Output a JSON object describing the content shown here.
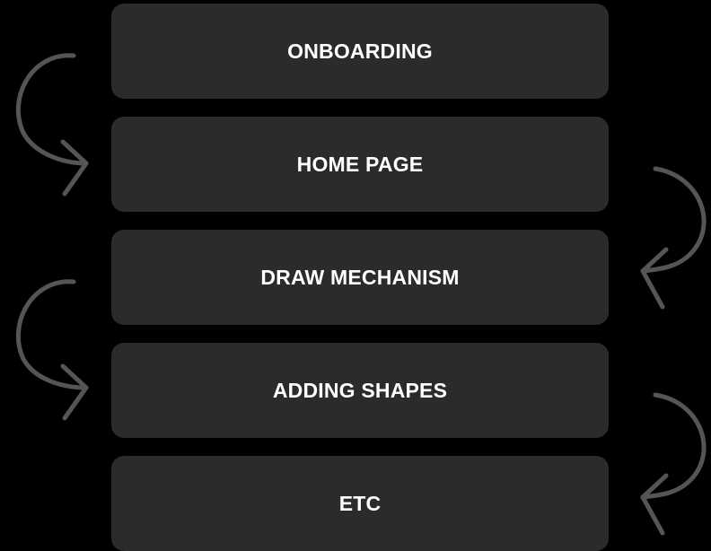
{
  "steps": [
    {
      "label": "ONBOARDING"
    },
    {
      "label": "HOME PAGE"
    },
    {
      "label": "DRAW MECHANISM"
    },
    {
      "label": "ADDING SHAPES"
    },
    {
      "label": "ETC"
    }
  ],
  "colors": {
    "background": "#000000",
    "box": "#2b2b2b",
    "text": "#ffffff",
    "arrow": "#555555"
  }
}
